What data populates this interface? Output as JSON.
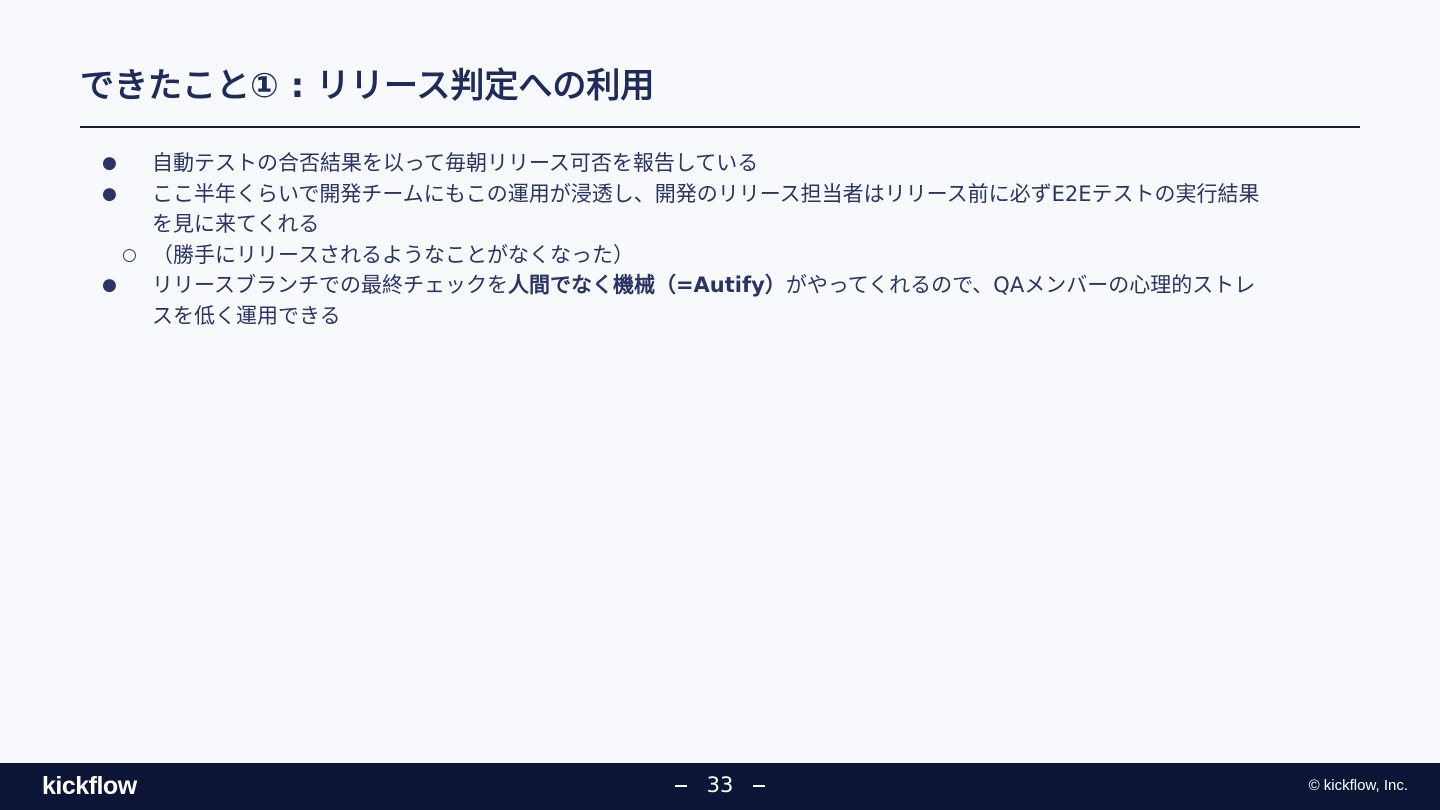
{
  "slide": {
    "title": "できたこと① : リリース判定への利用"
  },
  "bullets": {
    "marker": "●",
    "sub_marker": "○",
    "item1": "自動テストの合否結果を以って毎朝リリース可否を報告している",
    "item2": "ここ半年くらいで開発チームにもこの運用が浸透し、開発のリリース担当者はリリース前に必ずE2Eテストの実行結果を見に来てくれる",
    "item2_sub": "（勝手にリリースされるようなことがなくなった）",
    "item3_pre": "リリースブランチでの最終チェックを",
    "item3_bold": "人間でなく機械（=Autify）",
    "item3_post": "がやってくれるので、QAメンバーの心理的ストレスを低く運用できる"
  },
  "footer": {
    "logo": "kickflow",
    "page_number": "33",
    "copyright": "© kickflow, Inc."
  },
  "colors": {
    "background": "#f7f9fc",
    "text": "#2a3566",
    "title": "#1f2b5b",
    "footer_bg": "#0c1535"
  }
}
